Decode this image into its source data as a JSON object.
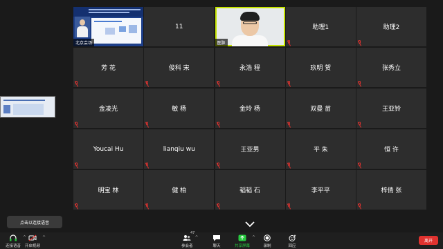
{
  "shared_screen_label": "北京会场",
  "speaker_label": "医肿",
  "participants_row1": [
    "11",
    "助理1",
    "助理2"
  ],
  "participants": [
    "芳 花",
    "俊科 宋",
    "永浩 程",
    "玖明 贺",
    "张秀立",
    "金凌光",
    "敏 杨",
    "金玲 杨",
    "双曼 苗",
    "王亚铃",
    "Youcai Hu",
    "lianqiu wu",
    "王亚男",
    "平 朱",
    "恒 许",
    "明宝 林",
    "健 柏",
    "韬韬 石",
    "李平平",
    "梓倩 张"
  ],
  "tooltip": "点击以连接语音",
  "toolbar": {
    "join_audio": "连接语音",
    "start_video": "开启视频",
    "participants": "参会者",
    "participants_count": "47",
    "chat": "聊天",
    "share_screen": "共享屏幕",
    "record": "录制",
    "reactions": "回应",
    "leave": "离开"
  },
  "colors": {
    "muted_mic": "#e0322f",
    "active_speaker": "#c5e300",
    "share": "#27c93f",
    "leave": "#e0322f"
  }
}
